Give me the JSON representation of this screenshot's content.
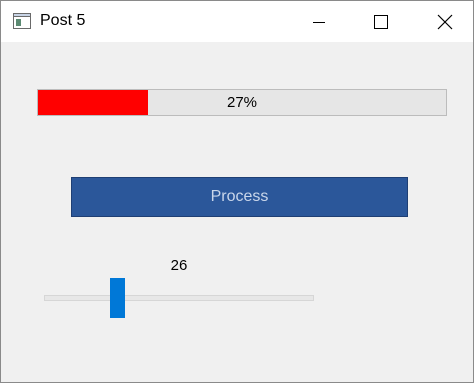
{
  "window": {
    "title": "Post 5",
    "icon": "app-window-icon",
    "controls": [
      "minimize-icon",
      "maximize-icon",
      "close-icon"
    ]
  },
  "progress": {
    "value": 27,
    "text": "27%",
    "fill_color": "#ff0000"
  },
  "process_button": {
    "label": "Process",
    "color": "#2b579a"
  },
  "slider": {
    "value": 26,
    "value_label": "26",
    "min": 0,
    "max": 100,
    "thumb_color": "#0078d7"
  }
}
